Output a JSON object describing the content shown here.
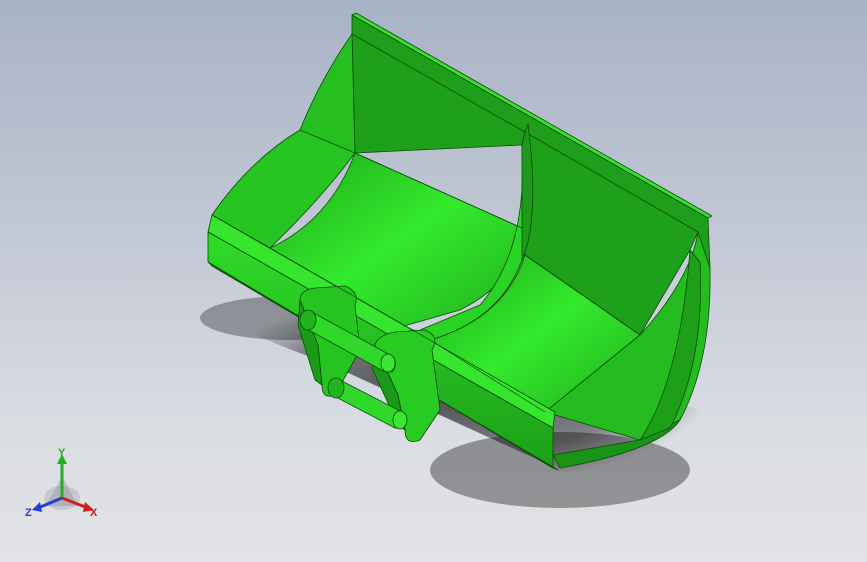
{
  "viewport": {
    "background_top": "#a8b3c6",
    "background_bottom": "#e2e3e6"
  },
  "model": {
    "name": "excavator-bucket",
    "color": "#22b41f",
    "highlight": "#33e62b",
    "shadow": "#189014"
  },
  "triad": {
    "x_label": "X",
    "y_label": "Y",
    "z_label": "Z",
    "x_color": "#d02020",
    "y_color": "#20b020",
    "z_color": "#2040d0"
  }
}
